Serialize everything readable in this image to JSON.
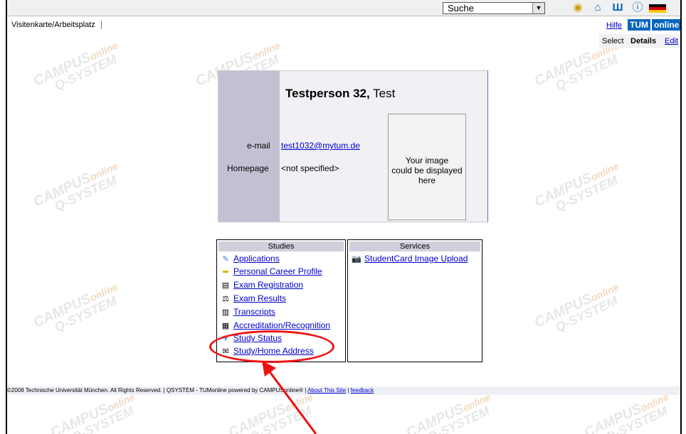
{
  "topbar": {
    "search_value": "Suche",
    "icons": [
      "help-circle-icon",
      "home-icon",
      "tum-logo-icon",
      "info-icon",
      "german-flag-icon"
    ]
  },
  "nav": {
    "breadcrumb": "Visitenkarte/Arbeitsplatz",
    "hilfe": "Hilfe",
    "logo_tum": "TUM",
    "logo_online": "online",
    "mode_select": "Select",
    "mode_details": "Details",
    "mode_edit": "Edit"
  },
  "watermark": {
    "line1": "CAMPUS",
    "line1b": "online",
    "line2": "Q-SYSTEM"
  },
  "person": {
    "last_name": "Testperson 32,",
    "first_name": "Test",
    "email_label": "e-mail",
    "email": "test1032@mytum.de",
    "homepage_label": "Homepage",
    "homepage_value": "<not specified>",
    "photo_placeholder_1": "Your image",
    "photo_placeholder_2": "could be displayed",
    "photo_placeholder_3": "here"
  },
  "studies": {
    "header": "Studies",
    "items": [
      {
        "label": "Applications",
        "icon": "pencil-icon"
      },
      {
        "label": "Personal Career Profile",
        "icon": "arrow-right-icon"
      },
      {
        "label": "Exam Registration",
        "icon": "computer-icon"
      },
      {
        "label": "Exam Results",
        "icon": "scale-icon"
      },
      {
        "label": "Transcripts",
        "icon": "document-icon"
      },
      {
        "label": "Accreditation/Recognition",
        "icon": "stamp-icon"
      },
      {
        "label": "Study Status",
        "icon": "chart-icon"
      },
      {
        "label": "Study/Home Address",
        "icon": "envelope-icon"
      }
    ]
  },
  "services": {
    "header": "Services",
    "items": [
      {
        "label": "StudentCard Image Upload",
        "icon": "camera-icon"
      }
    ]
  },
  "footer": {
    "text": "©2008 Technische Universität München. All Rights Reserved. | QSYSTEM - TUMonline powered by CAMPUSonline® |",
    "about": "About This Site",
    "sep": "|",
    "feedback": "feedback"
  },
  "colors": {
    "link": "#0000cc",
    "card_bg": "#f2f0f4",
    "card_left": "#c4c0d4",
    "annotation": "#ee1111",
    "tum_blue": "#0065bd"
  }
}
